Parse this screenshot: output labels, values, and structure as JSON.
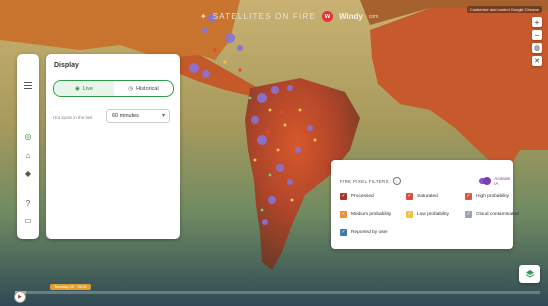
{
  "header": {
    "title": "SATELLITES ON FIRE",
    "brand": "Windy",
    "brand_suffix": "com",
    "top_right_text": "Customize and control Google Chrome"
  },
  "map_controls": {
    "zoom_in": "+",
    "zoom_out": "−",
    "layers_icon": "layers-icon"
  },
  "sidebar": {
    "icons": [
      "menu-icon",
      "fire-icon",
      "bank-icon",
      "map-pin-icon",
      "help-icon",
      "chat-icon"
    ]
  },
  "display_panel": {
    "title": "Display",
    "toggle": {
      "live_label": "Live",
      "historical_label": "Historical",
      "selected": "Live"
    },
    "hot_spots_label": "Hot spots in the last",
    "hot_spots_value": "60 minutes"
  },
  "filters_panel": {
    "title": "FIRE PIXEL FILTERS",
    "activate_label": "Activate IA",
    "activate_on": true,
    "options": [
      {
        "label": "Processed",
        "checked": true,
        "color": "#a8352c"
      },
      {
        "label": "Saturated",
        "checked": true,
        "color": "#d8503a"
      },
      {
        "label": "High probability",
        "checked": true,
        "color": "#e0553a"
      },
      {
        "label": "Medium probability",
        "checked": true,
        "color": "#ef8f33"
      },
      {
        "label": "Low probability",
        "checked": true,
        "color": "#f3c23b"
      },
      {
        "label": "Cloud contaminated",
        "checked": true,
        "color": "#9aa3b6"
      },
      {
        "label": "Reported by user",
        "checked": true,
        "color": "#3c7ca8"
      }
    ]
  },
  "timeline": {
    "time_label": "Tuesday 28 · 19:00",
    "progress": 0.02
  },
  "colors": {
    "accent_green": "#2f9a4a",
    "accent_purple": "#7b3fb5",
    "fire_red": "#e0363a"
  }
}
